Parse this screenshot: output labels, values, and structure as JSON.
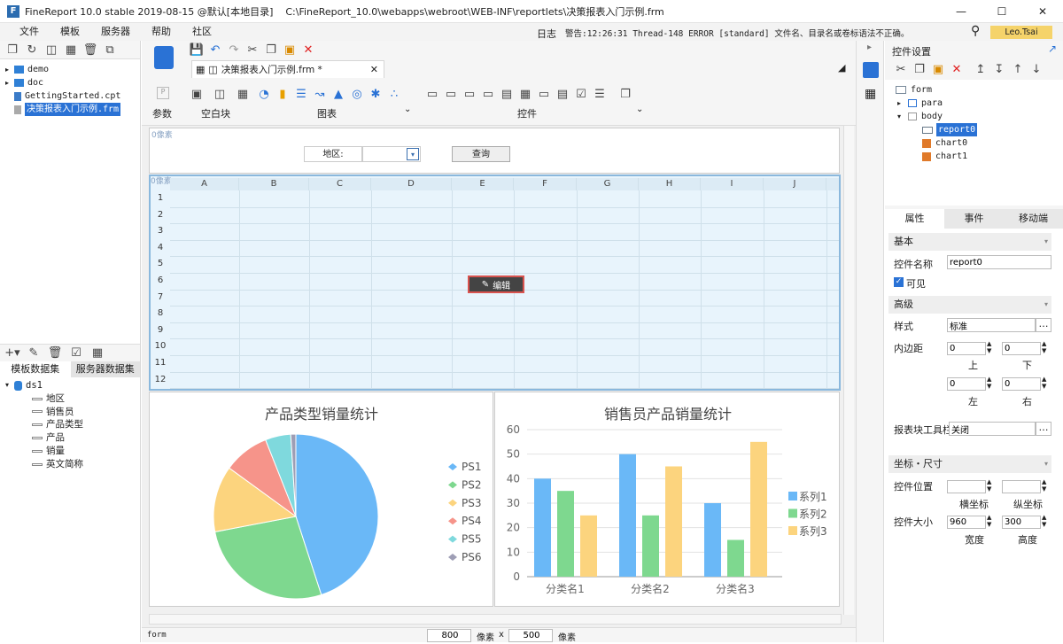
{
  "window": {
    "title": "FineReport 10.0 stable 2019-08-15 @默认[本地目录]    C:\\FineReport_10.0\\webapps\\webroot\\WEB-INF\\reportlets\\决策报表入门示例.frm",
    "controls": [
      "—",
      "☐",
      "✕"
    ]
  },
  "menu": [
    "文件",
    "模板",
    "服务器",
    "帮助",
    "社区"
  ],
  "status": {
    "log": "日志",
    "alert": "警告:12:26:31 Thread-148 ERROR [standard] 文件名、目录名或卷标语法不正确。",
    "user": "Leo.Tsai"
  },
  "filetree": [
    {
      "label": "demo",
      "type": "folder"
    },
    {
      "label": "doc",
      "type": "folder"
    },
    {
      "label": "GettingStarted.cpt",
      "type": "cpt"
    },
    {
      "label": "决策报表入门示例.frm",
      "type": "frm",
      "selected": true
    }
  ],
  "datasets": {
    "tabs": [
      "模板数据集",
      "服务器数据集"
    ],
    "root": "ds1",
    "fields": [
      "地区",
      "销售员",
      "产品类型",
      "产品",
      "销量",
      "英文简称"
    ]
  },
  "editor_tab": {
    "label": "决策报表入门示例.frm *"
  },
  "ribbon": {
    "groups": [
      "参数",
      "空白块",
      "图表",
      "控件"
    ]
  },
  "canvas": {
    "para_label": "0像素",
    "region_label": "地区:",
    "query_button": "查询",
    "body_label": "0像素",
    "edit_button": "编辑",
    "columns": [
      "A",
      "B",
      "C",
      "D",
      "E",
      "F",
      "G",
      "H",
      "I",
      "J"
    ],
    "rows": [
      "1",
      "2",
      "3",
      "4",
      "5",
      "6",
      "7",
      "8",
      "9",
      "10",
      "11",
      "12"
    ]
  },
  "chart_data": [
    {
      "type": "pie",
      "title": "产品类型销量统计",
      "categories": [
        "PS1",
        "PS2",
        "PS3",
        "PS4",
        "PS5",
        "PS6"
      ],
      "values": [
        45,
        27,
        13,
        9,
        5,
        1
      ],
      "colors": [
        "#6ab8f7",
        "#7ed88f",
        "#fcd47e",
        "#f6948a",
        "#7fd9dd",
        "#9e9eb5"
      ]
    },
    {
      "type": "bar",
      "title": "销售员产品销量统计",
      "categories": [
        "分类名1",
        "分类名2",
        "分类名3"
      ],
      "series": [
        {
          "name": "系列1",
          "values": [
            40,
            50,
            30
          ]
        },
        {
          "name": "系列2",
          "values": [
            35,
            25,
            15
          ]
        },
        {
          "name": "系列3",
          "values": [
            25,
            45,
            55
          ]
        }
      ],
      "ylim": [
        0,
        60
      ],
      "yticks": [
        "0",
        "10",
        "20",
        "30",
        "40",
        "50",
        "60"
      ],
      "colors": [
        "#6ab8f7",
        "#7ed88f",
        "#fcd47e"
      ],
      "legend": "right"
    }
  ],
  "bottom": {
    "form": "form",
    "width": "800",
    "unit1": "像素",
    "x": "x",
    "height": "500",
    "unit2": "像素"
  },
  "right_panel": {
    "title": "控件设置",
    "tree": [
      {
        "label": "form"
      },
      {
        "label": "para"
      },
      {
        "label": "body"
      },
      {
        "label": "report0",
        "selected": true
      },
      {
        "label": "chart0"
      },
      {
        "label": "chart1"
      }
    ],
    "tabs": [
      "属性",
      "事件",
      "移动端"
    ],
    "basic": {
      "section": "基本",
      "name_label": "控件名称",
      "name_value": "report0",
      "visible_label": "可见"
    },
    "advanced": {
      "section": "高级",
      "style_label": "样式",
      "style_value": "标准",
      "padding_label": "内边距",
      "pad_top": "0",
      "pad_bottom": "0",
      "pad_left": "0",
      "pad_right": "0",
      "top": "上",
      "bottom": "下",
      "left": "左",
      "right": "右",
      "toolbar_label": "报表块工具栏",
      "toolbar_value": "关闭"
    },
    "coords": {
      "section": "坐标・尺寸",
      "pos_label": "控件位置",
      "x_label": "横坐标",
      "y_label": "纵坐标",
      "size_label": "控件大小",
      "width_value": "960",
      "height_value": "300",
      "w_label": "宽度",
      "h_label": "高度"
    }
  }
}
